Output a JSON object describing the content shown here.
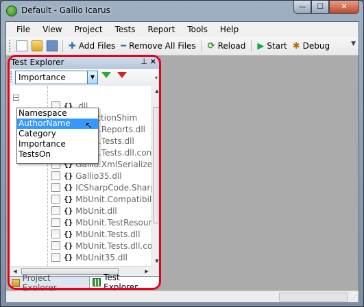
{
  "window": {
    "title": "Default - Gallio Icarus",
    "minimize_glyph": "—",
    "maximize_glyph": "☐",
    "close_glyph": "✕"
  },
  "menu": [
    "File",
    "View",
    "Project",
    "Tests",
    "Report",
    "Tools",
    "Help"
  ],
  "toolbar": {
    "add_files": "Add Files",
    "remove_all_files": "Remove All Files",
    "reload": "Reload",
    "start": "Start",
    "debug": "Debug",
    "add_glyph": "✚",
    "remove_glyph": "━",
    "reload_glyph": "⟳",
    "start_glyph": "▶",
    "debug_glyph": "✱",
    "overflow_glyph": "▼"
  },
  "test_explorer": {
    "title": "Test Explorer",
    "pin_glyph": "⊥",
    "close_glyph": "×",
    "tree_by": "Importance",
    "dropdown_arrow": "▼",
    "filter_overflow": "▾",
    "dropdown_options": [
      "Namespace",
      "AuthorName",
      "Category",
      "Importance",
      "TestsOn"
    ],
    "highlighted_option": "AuthorName",
    "tree_items": [
      {
        "label": ".dll",
        "indent_partial": true
      },
      {
        "label": "ReflectionShim",
        "indent_partial": true
      },
      {
        "label": "Gallio.Reports.dll",
        "indent_partial": true
      },
      {
        "label": "Gallio.Tests.dll"
      },
      {
        "label": "Gallio.Tests.dll.config"
      },
      {
        "label": "Gallio.XmlSerializers.dll"
      },
      {
        "label": "Gallio35.dll"
      },
      {
        "label": "ICSharpCode.SharpZipLib.dll"
      },
      {
        "label": "MbUnit.Compatibility.dll"
      },
      {
        "label": "MbUnit.dll"
      },
      {
        "label": "MbUnit.TestResources.dll"
      },
      {
        "label": "MbUnit.Tests.dll"
      },
      {
        "label": "MbUnit.Tests.dll.config"
      },
      {
        "label": "MbUnit35.dll"
      }
    ],
    "ns_glyph": "{}",
    "expander_glyph": "−",
    "hscroll_thumb_glyph": "|||",
    "tabs": [
      {
        "label": "Project Explorer",
        "active": false
      },
      {
        "label": "Test Explorer",
        "active": true
      }
    ]
  },
  "scroll_glyphs": {
    "up": "▲",
    "down": "▼",
    "left": "◀",
    "right": "▶"
  },
  "statusbar": {
    "resize_glyph": "⋰"
  },
  "cursor_glyph": "↖"
}
